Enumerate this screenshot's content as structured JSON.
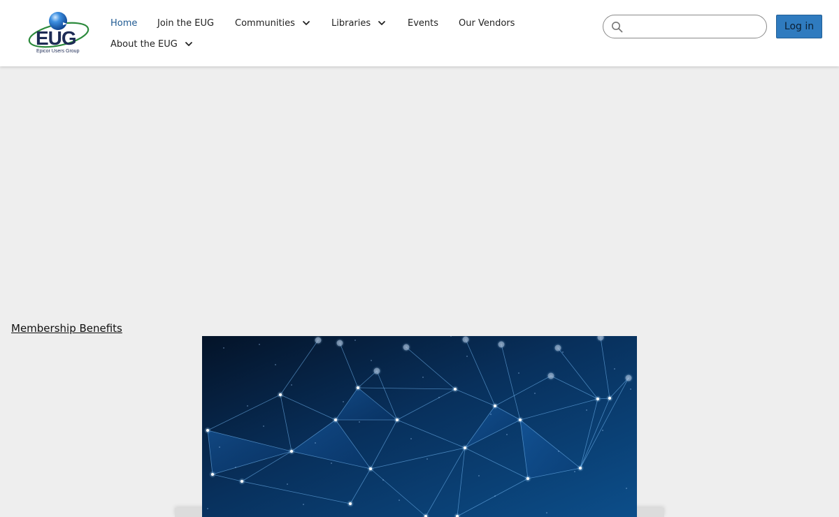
{
  "logo": {
    "text": "EUG",
    "subtext": "Epicor Users Group"
  },
  "nav": {
    "items": [
      {
        "label": "Home",
        "active": true,
        "has_dropdown": false
      },
      {
        "label": "Join the EUG",
        "active": false,
        "has_dropdown": false
      },
      {
        "label": "Communities",
        "active": false,
        "has_dropdown": true
      },
      {
        "label": "Libraries",
        "active": false,
        "has_dropdown": true
      },
      {
        "label": "Events",
        "active": false,
        "has_dropdown": false
      },
      {
        "label": "Our Vendors",
        "active": false,
        "has_dropdown": false
      },
      {
        "label": "About the EUG",
        "active": false,
        "has_dropdown": true
      }
    ]
  },
  "search": {
    "value": "",
    "icon": "search-icon"
  },
  "header": {
    "login_label": "Log in"
  },
  "content": {
    "benefits_link": "Membership Benefits"
  },
  "colors": {
    "accent": "#1f5a92",
    "button": "#2f7bbf",
    "page_bg": "#eeeeee"
  }
}
